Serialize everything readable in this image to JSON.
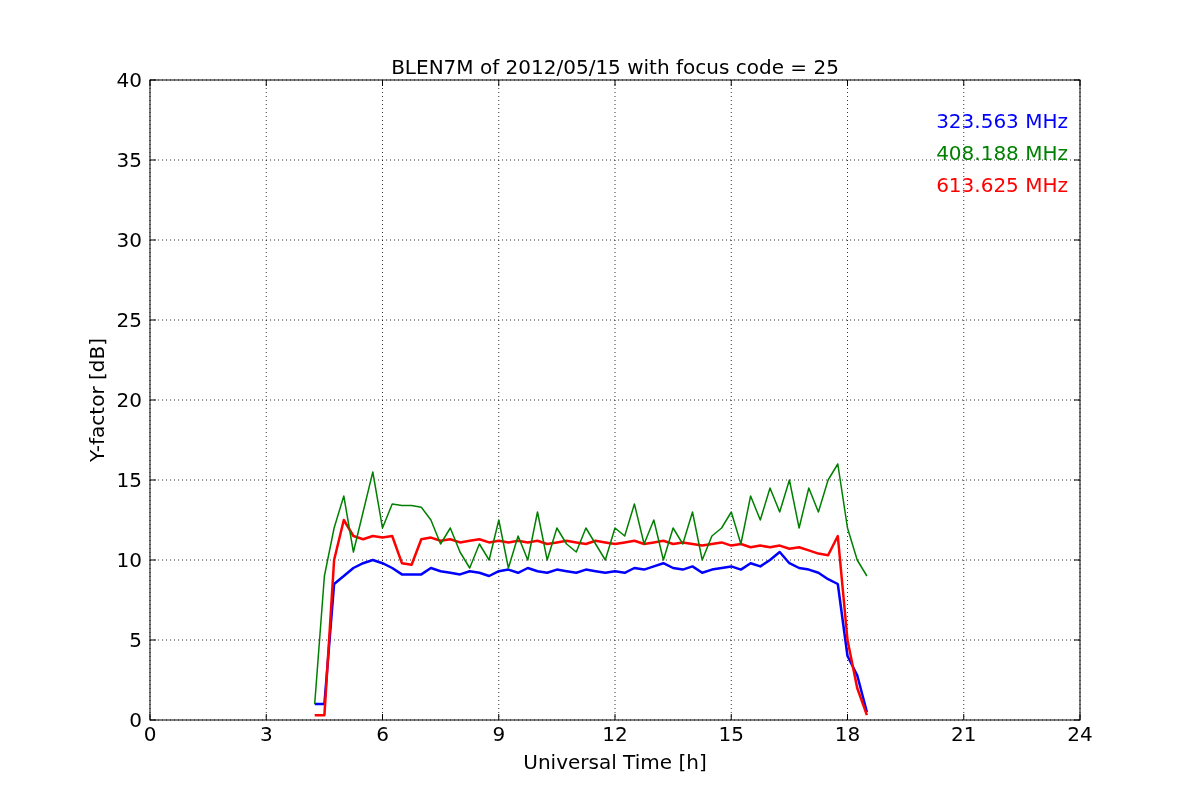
{
  "chart_data": {
    "type": "line",
    "title": "BLEN7M of 2012/05/15 with focus code = 25",
    "xlabel": "Universal Time [h]",
    "ylabel": "Y-factor [dB]",
    "x": [
      4.25,
      4.5,
      4.75,
      5,
      5.25,
      5.5,
      5.75,
      6,
      6.25,
      6.5,
      6.75,
      7,
      7.25,
      7.5,
      7.75,
      8,
      8.25,
      8.5,
      8.75,
      9,
      9.25,
      9.5,
      9.75,
      10,
      10.25,
      10.5,
      10.75,
      11,
      11.25,
      11.5,
      11.75,
      12,
      12.25,
      12.5,
      12.75,
      13,
      13.25,
      13.5,
      13.75,
      14,
      14.25,
      14.5,
      14.75,
      15,
      15.25,
      15.5,
      15.75,
      16,
      16.25,
      16.5,
      16.75,
      17,
      17.25,
      17.5,
      17.75,
      18,
      18.25,
      18.5
    ],
    "series": [
      {
        "name": "323.563 MHz",
        "color": "#0000ff",
        "values": [
          1,
          1,
          8.5,
          9,
          9.5,
          9.8,
          10,
          9.8,
          9.5,
          9.1,
          9.1,
          9.1,
          9.5,
          9.3,
          9.2,
          9.1,
          9.3,
          9.2,
          9.0,
          9.3,
          9.4,
          9.2,
          9.5,
          9.3,
          9.2,
          9.4,
          9.3,
          9.2,
          9.4,
          9.3,
          9.2,
          9.3,
          9.2,
          9.5,
          9.4,
          9.6,
          9.8,
          9.5,
          9.4,
          9.6,
          9.2,
          9.4,
          9.5,
          9.6,
          9.4,
          9.8,
          9.6,
          10,
          10.5,
          9.8,
          9.5,
          9.4,
          9.2,
          8.8,
          8.5,
          4,
          2.8,
          0.5
        ]
      },
      {
        "name": "408.188 MHz",
        "color": "#008000",
        "values": [
          1,
          9,
          12,
          14,
          10.5,
          13,
          15.5,
          12,
          13.5,
          13.4,
          13.4,
          13.3,
          12.5,
          11,
          12,
          10.5,
          9.5,
          11,
          10,
          12.5,
          9.5,
          11.5,
          10,
          13,
          10,
          12,
          11,
          10.5,
          12,
          11,
          10,
          12,
          11.5,
          13.5,
          11,
          12.5,
          10,
          12,
          11,
          13,
          10,
          11.5,
          12,
          13,
          11,
          14,
          12.5,
          14.5,
          13,
          15,
          12,
          14.5,
          13,
          15,
          16,
          12,
          10,
          9
        ]
      },
      {
        "name": "613.625 MHz",
        "color": "#ff0000",
        "values": [
          0.3,
          0.3,
          10,
          12.5,
          11.5,
          11.3,
          11.5,
          11.4,
          11.5,
          9.8,
          9.7,
          11.3,
          11.4,
          11.2,
          11.3,
          11.1,
          11.2,
          11.3,
          11.1,
          11.2,
          11.1,
          11.2,
          11.1,
          11.2,
          11.0,
          11.1,
          11.2,
          11.1,
          11.0,
          11.2,
          11.1,
          11.0,
          11.1,
          11.2,
          11.0,
          11.1,
          11.2,
          11.0,
          11.1,
          11.0,
          10.9,
          11.0,
          11.1,
          10.9,
          11.0,
          10.8,
          10.9,
          10.8,
          10.9,
          10.7,
          10.8,
          10.6,
          10.4,
          10.3,
          11.5,
          5,
          2,
          0.3
        ]
      }
    ],
    "xlim": [
      0,
      24
    ],
    "ylim": [
      0,
      40
    ],
    "xticks": [
      0,
      3,
      6,
      9,
      12,
      15,
      18,
      21,
      24
    ],
    "yticks": [
      0,
      5,
      10,
      15,
      20,
      25,
      30,
      35,
      40
    ],
    "grid": true
  }
}
